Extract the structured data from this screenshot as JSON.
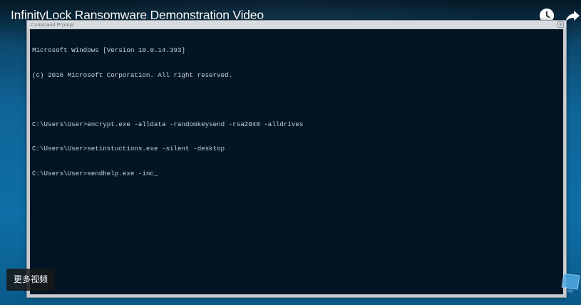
{
  "player": {
    "title": "InfinityLock Ransomware Demonstration Video",
    "watch_later_icon": "clock-icon",
    "share_icon": "share-arrow-icon",
    "more_videos_label": "更多视频",
    "background_color": "#0d6fa6"
  },
  "window": {
    "title": "Command Prompt",
    "close_glyph": "⊗",
    "body_color": "#031524",
    "text_color": "#c9d3db"
  },
  "console": {
    "lines": [
      "Microsoft Windows [Version 10.0.14.393]",
      "(c) 2016 Microsoft Corporation. All right reserved.",
      "",
      "C:\\Users\\User>encrypt.exe -alldata -randomkeysend -rsa2048 -alldrives",
      "C:\\Users\\User>setinstuctions.exe -silent -desktop",
      "C:\\Users\\User>sendhelp.exe -inc_"
    ]
  }
}
